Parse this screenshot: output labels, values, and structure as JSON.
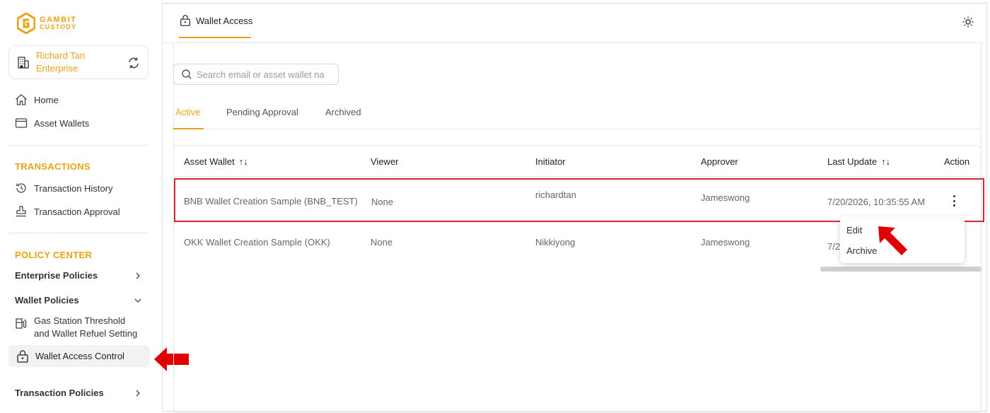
{
  "brand": {
    "line1": "GAMBIT",
    "line2": "CUSTODY",
    "color": "#e8a317"
  },
  "org": {
    "name": "Richard Tan Enterprise"
  },
  "sidebar": {
    "home": "Home",
    "asset_wallets": "Asset Wallets",
    "transactions_title": "TRANSACTIONS",
    "transaction_history": "Transaction History",
    "transaction_approval": "Transaction Approval",
    "policy_center_title": "POLICY CENTER",
    "enterprise_policies": "Enterprise Policies",
    "wallet_policies": "Wallet Policies",
    "gas_station": "Gas Station Threshold and Wallet Refuel Setting",
    "wallet_access_control": "Wallet Access Control",
    "transaction_policies": "Transaction Policies"
  },
  "header": {
    "tab_label": "Wallet Access"
  },
  "search": {
    "placeholder": "Search email or asset wallet name"
  },
  "tabs": {
    "active": "Active",
    "pending": "Pending Approval",
    "archived": "Archived"
  },
  "table": {
    "columns": {
      "asset_wallet": "Asset Wallet",
      "viewer": "Viewer",
      "initiator": "Initiator",
      "approver": "Approver",
      "last_update": "Last Update",
      "action": "Action"
    },
    "sort_icon": "↑↓",
    "rows": [
      {
        "asset_wallet": "BNB Wallet Creation Sample (BNB_TEST)",
        "viewer": "None",
        "initiator": "richardtan",
        "approver": "Jameswong",
        "last_update": "7/20/2026, 10:35:55 AM"
      },
      {
        "asset_wallet": "OKK Wallet Creation Sample (OKK)",
        "viewer": "None",
        "initiator": "Nikkiyong",
        "approver": "Jameswong",
        "last_update": "7/2"
      }
    ]
  },
  "action_menu": {
    "edit": "Edit",
    "archive": "Archive"
  },
  "colors": {
    "accent": "#e8a317",
    "highlight": "#d9252f",
    "arrow": "#e00000"
  }
}
